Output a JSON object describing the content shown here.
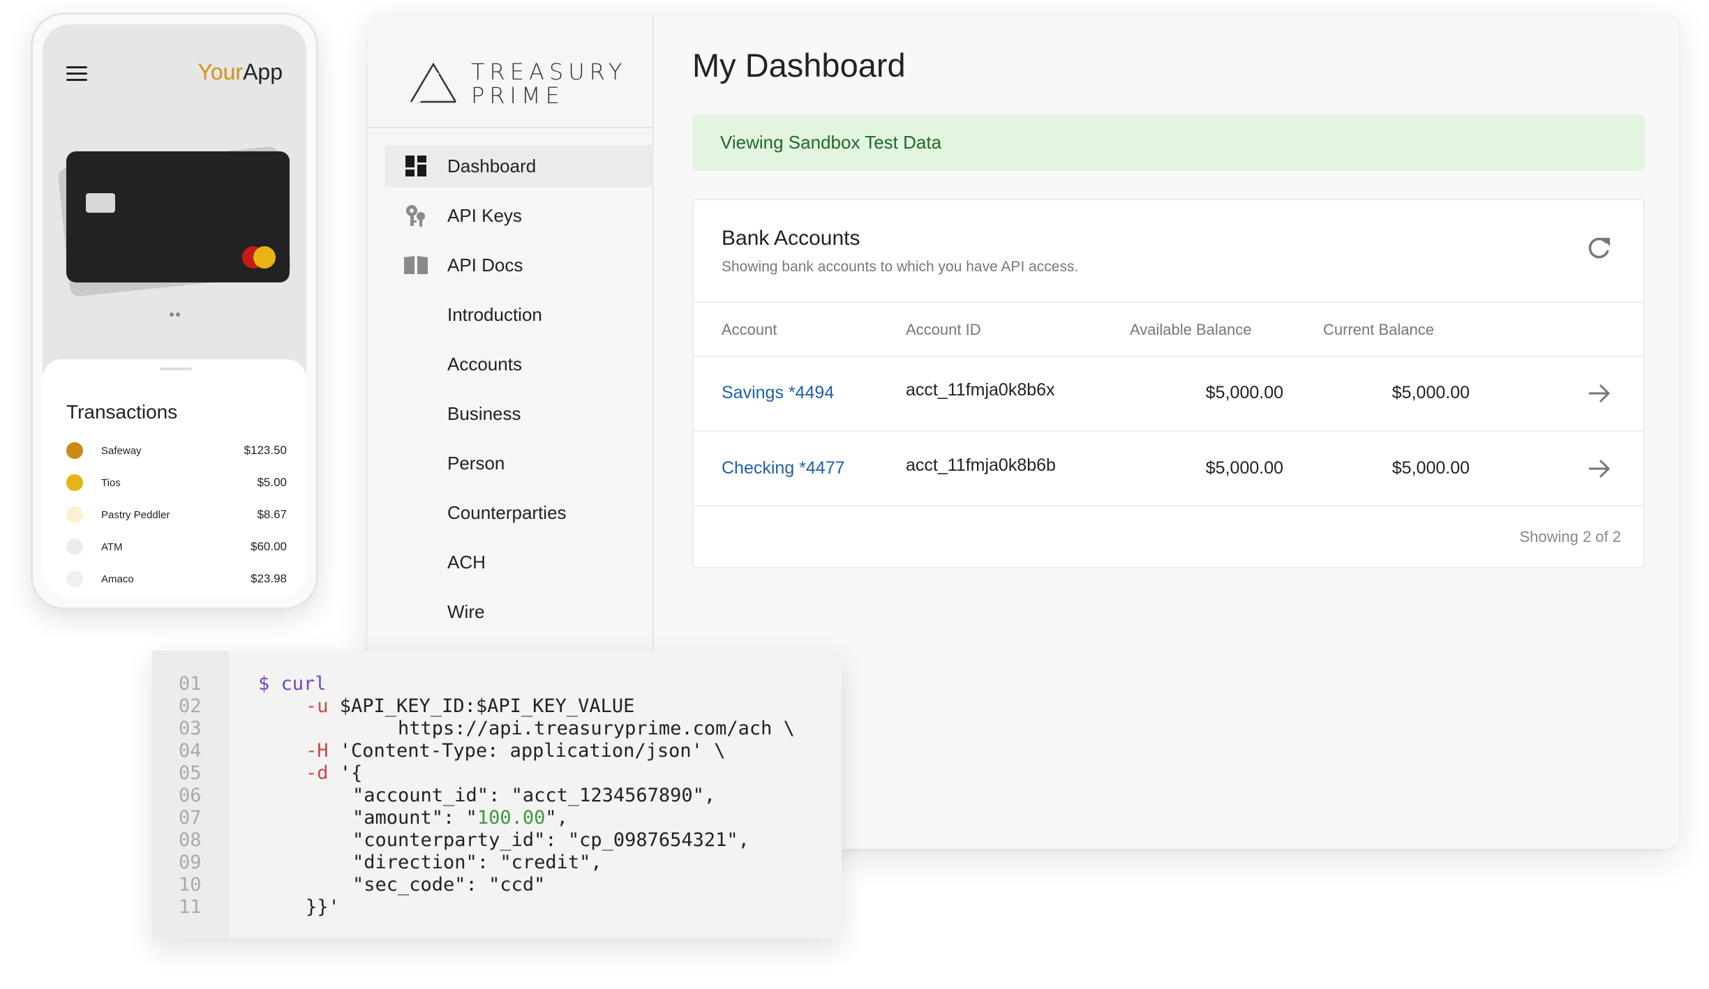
{
  "brand": {
    "line1": "TREASURY",
    "line2": "PRIME"
  },
  "nav": [
    {
      "label": "Dashboard",
      "icon": "dashboard-icon",
      "active": true
    },
    {
      "label": "API Keys",
      "icon": "key-icon"
    },
    {
      "label": "API Docs",
      "icon": "book-icon"
    },
    {
      "label": "Introduction"
    },
    {
      "label": "Accounts"
    },
    {
      "label": "Business"
    },
    {
      "label": "Person"
    },
    {
      "label": "Counterparties"
    },
    {
      "label": "ACH"
    },
    {
      "label": "Wire"
    }
  ],
  "page": {
    "title": "My Dashboard",
    "banner": "Viewing Sandbox Test Data"
  },
  "bank_accounts": {
    "title": "Bank Accounts",
    "subtitle": "Showing bank accounts to which you have API access.",
    "columns": [
      "Account",
      "Account ID",
      "Available Balance",
      "Current Balance"
    ],
    "rows": [
      {
        "account": "Savings *4494",
        "account_id": "acct_11fmja0k8b6x",
        "available": "$5,000.00",
        "current": "$5,000.00"
      },
      {
        "account": "Checking *4477",
        "account_id": "acct_11fmja0k8b6b",
        "available": "$5,000.00",
        "current": "$5,000.00"
      }
    ],
    "footer": "Showing 2 of 2"
  },
  "phone": {
    "app_name_accent": "Your",
    "app_name_rest": "App",
    "transactions_title": "Transactions",
    "transactions": [
      {
        "name": "Safeway",
        "amount": "$123.50",
        "color": "#c98a14"
      },
      {
        "name": "Tios",
        "amount": "$5.00",
        "color": "#e4b418"
      },
      {
        "name": "Pastry Peddler",
        "amount": "$8.67",
        "color": "#fbf1d2"
      },
      {
        "name": "ATM",
        "amount": "$60.00",
        "color": "#ececec"
      },
      {
        "name": "Amaco",
        "amount": "$23.98",
        "color": "#f0f0f0"
      }
    ]
  },
  "code": {
    "line_numbers": [
      "01",
      "02",
      "03",
      "04",
      "05",
      "06",
      "07",
      "08",
      "09",
      "10",
      "11"
    ],
    "l1_prompt": "$ curl",
    "l2_flag": "-u",
    "l2_rest": " $API_KEY_ID:$API_KEY_VALUE",
    "l3": "https://api.treasuryprime.com/ach \\",
    "l4_flag": "-H",
    "l4_rest": " 'Content-Type: application/json' \\",
    "l5_flag": "-d",
    "l5_rest": " '{",
    "l6": "\"account_id\": \"acct_1234567890\",",
    "l7_pre": "\"amount\": \"",
    "l7_val": "100.00",
    "l7_post": "\",",
    "l8": "\"counterparty_id\": \"cp_0987654321\",",
    "l9": "\"direction\": \"credit\",",
    "l10": "\"sec_code\": \"ccd\"",
    "l11": "}}'"
  }
}
